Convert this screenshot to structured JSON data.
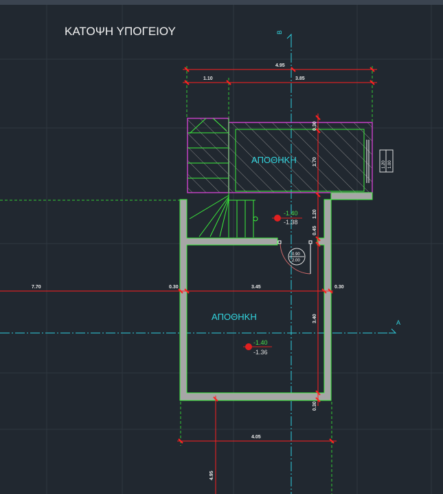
{
  "title": "ΚΑΤΟΨΗ ΥΠΟΓΕΙΟΥ",
  "rooms": [
    {
      "label": "ΑΠΟΘΗΚΗ"
    },
    {
      "label": "ΑΠΟΘΗΚΗ"
    }
  ],
  "levels": [
    {
      "top": "-1.40",
      "bottom": "-1.38"
    },
    {
      "top": "-1.40",
      "bottom": "-1.36"
    }
  ],
  "door_tag": {
    "width": "0.90",
    "height": "2.00"
  },
  "window_tag": {
    "width": "1.20",
    "height": "1.00"
  },
  "axes": {
    "vertical": "B",
    "horizontal": "A"
  },
  "dimensions": {
    "top_total": "4.95",
    "top_left": "1.10",
    "top_right": "3.85",
    "left_overall": "7.70",
    "wall_left": "0.30",
    "middle": "3.45",
    "wall_right": "0.30",
    "bottom_total": "4.05",
    "bottom_side": "4.95",
    "vert_upper_a": "0.30",
    "vert_upper_b": "1.70",
    "vert_mid_a": "1.20",
    "vert_mid_b": "0.45",
    "vert_lower_a": "3.40",
    "vert_lower_b": "0.30"
  },
  "colors": {
    "background": "#212830",
    "wall_fill": "#a6a6a6",
    "wall_edge": "#3cf03c",
    "storage_outline": "#c040c0",
    "dimension_line": "#ff2020",
    "axis_line": "#2fd0e0",
    "extension_line": "#33cc33"
  }
}
